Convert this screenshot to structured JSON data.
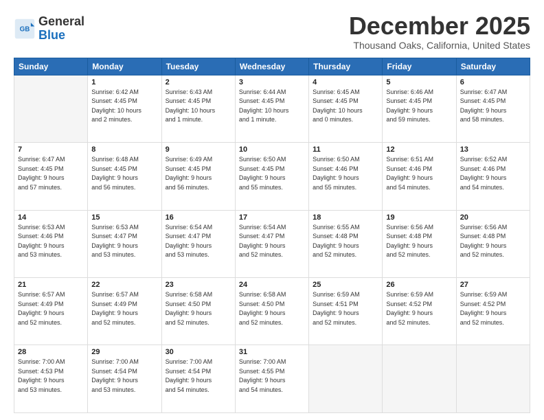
{
  "header": {
    "logo_line1": "General",
    "logo_line2": "Blue",
    "month": "December 2025",
    "location": "Thousand Oaks, California, United States"
  },
  "weekdays": [
    "Sunday",
    "Monday",
    "Tuesday",
    "Wednesday",
    "Thursday",
    "Friday",
    "Saturday"
  ],
  "weeks": [
    [
      {
        "day": "",
        "info": ""
      },
      {
        "day": "1",
        "info": "Sunrise: 6:42 AM\nSunset: 4:45 PM\nDaylight: 10 hours\nand 2 minutes."
      },
      {
        "day": "2",
        "info": "Sunrise: 6:43 AM\nSunset: 4:45 PM\nDaylight: 10 hours\nand 1 minute."
      },
      {
        "day": "3",
        "info": "Sunrise: 6:44 AM\nSunset: 4:45 PM\nDaylight: 10 hours\nand 1 minute."
      },
      {
        "day": "4",
        "info": "Sunrise: 6:45 AM\nSunset: 4:45 PM\nDaylight: 10 hours\nand 0 minutes."
      },
      {
        "day": "5",
        "info": "Sunrise: 6:46 AM\nSunset: 4:45 PM\nDaylight: 9 hours\nand 59 minutes."
      },
      {
        "day": "6",
        "info": "Sunrise: 6:47 AM\nSunset: 4:45 PM\nDaylight: 9 hours\nand 58 minutes."
      }
    ],
    [
      {
        "day": "7",
        "info": "Sunrise: 6:47 AM\nSunset: 4:45 PM\nDaylight: 9 hours\nand 57 minutes."
      },
      {
        "day": "8",
        "info": "Sunrise: 6:48 AM\nSunset: 4:45 PM\nDaylight: 9 hours\nand 56 minutes."
      },
      {
        "day": "9",
        "info": "Sunrise: 6:49 AM\nSunset: 4:45 PM\nDaylight: 9 hours\nand 56 minutes."
      },
      {
        "day": "10",
        "info": "Sunrise: 6:50 AM\nSunset: 4:45 PM\nDaylight: 9 hours\nand 55 minutes."
      },
      {
        "day": "11",
        "info": "Sunrise: 6:50 AM\nSunset: 4:46 PM\nDaylight: 9 hours\nand 55 minutes."
      },
      {
        "day": "12",
        "info": "Sunrise: 6:51 AM\nSunset: 4:46 PM\nDaylight: 9 hours\nand 54 minutes."
      },
      {
        "day": "13",
        "info": "Sunrise: 6:52 AM\nSunset: 4:46 PM\nDaylight: 9 hours\nand 54 minutes."
      }
    ],
    [
      {
        "day": "14",
        "info": "Sunrise: 6:53 AM\nSunset: 4:46 PM\nDaylight: 9 hours\nand 53 minutes."
      },
      {
        "day": "15",
        "info": "Sunrise: 6:53 AM\nSunset: 4:47 PM\nDaylight: 9 hours\nand 53 minutes."
      },
      {
        "day": "16",
        "info": "Sunrise: 6:54 AM\nSunset: 4:47 PM\nDaylight: 9 hours\nand 53 minutes."
      },
      {
        "day": "17",
        "info": "Sunrise: 6:54 AM\nSunset: 4:47 PM\nDaylight: 9 hours\nand 52 minutes."
      },
      {
        "day": "18",
        "info": "Sunrise: 6:55 AM\nSunset: 4:48 PM\nDaylight: 9 hours\nand 52 minutes."
      },
      {
        "day": "19",
        "info": "Sunrise: 6:56 AM\nSunset: 4:48 PM\nDaylight: 9 hours\nand 52 minutes."
      },
      {
        "day": "20",
        "info": "Sunrise: 6:56 AM\nSunset: 4:48 PM\nDaylight: 9 hours\nand 52 minutes."
      }
    ],
    [
      {
        "day": "21",
        "info": "Sunrise: 6:57 AM\nSunset: 4:49 PM\nDaylight: 9 hours\nand 52 minutes."
      },
      {
        "day": "22",
        "info": "Sunrise: 6:57 AM\nSunset: 4:49 PM\nDaylight: 9 hours\nand 52 minutes."
      },
      {
        "day": "23",
        "info": "Sunrise: 6:58 AM\nSunset: 4:50 PM\nDaylight: 9 hours\nand 52 minutes."
      },
      {
        "day": "24",
        "info": "Sunrise: 6:58 AM\nSunset: 4:50 PM\nDaylight: 9 hours\nand 52 minutes."
      },
      {
        "day": "25",
        "info": "Sunrise: 6:59 AM\nSunset: 4:51 PM\nDaylight: 9 hours\nand 52 minutes."
      },
      {
        "day": "26",
        "info": "Sunrise: 6:59 AM\nSunset: 4:52 PM\nDaylight: 9 hours\nand 52 minutes."
      },
      {
        "day": "27",
        "info": "Sunrise: 6:59 AM\nSunset: 4:52 PM\nDaylight: 9 hours\nand 52 minutes."
      }
    ],
    [
      {
        "day": "28",
        "info": "Sunrise: 7:00 AM\nSunset: 4:53 PM\nDaylight: 9 hours\nand 53 minutes."
      },
      {
        "day": "29",
        "info": "Sunrise: 7:00 AM\nSunset: 4:54 PM\nDaylight: 9 hours\nand 53 minutes."
      },
      {
        "day": "30",
        "info": "Sunrise: 7:00 AM\nSunset: 4:54 PM\nDaylight: 9 hours\nand 54 minutes."
      },
      {
        "day": "31",
        "info": "Sunrise: 7:00 AM\nSunset: 4:55 PM\nDaylight: 9 hours\nand 54 minutes."
      },
      {
        "day": "",
        "info": ""
      },
      {
        "day": "",
        "info": ""
      },
      {
        "day": "",
        "info": ""
      }
    ]
  ]
}
